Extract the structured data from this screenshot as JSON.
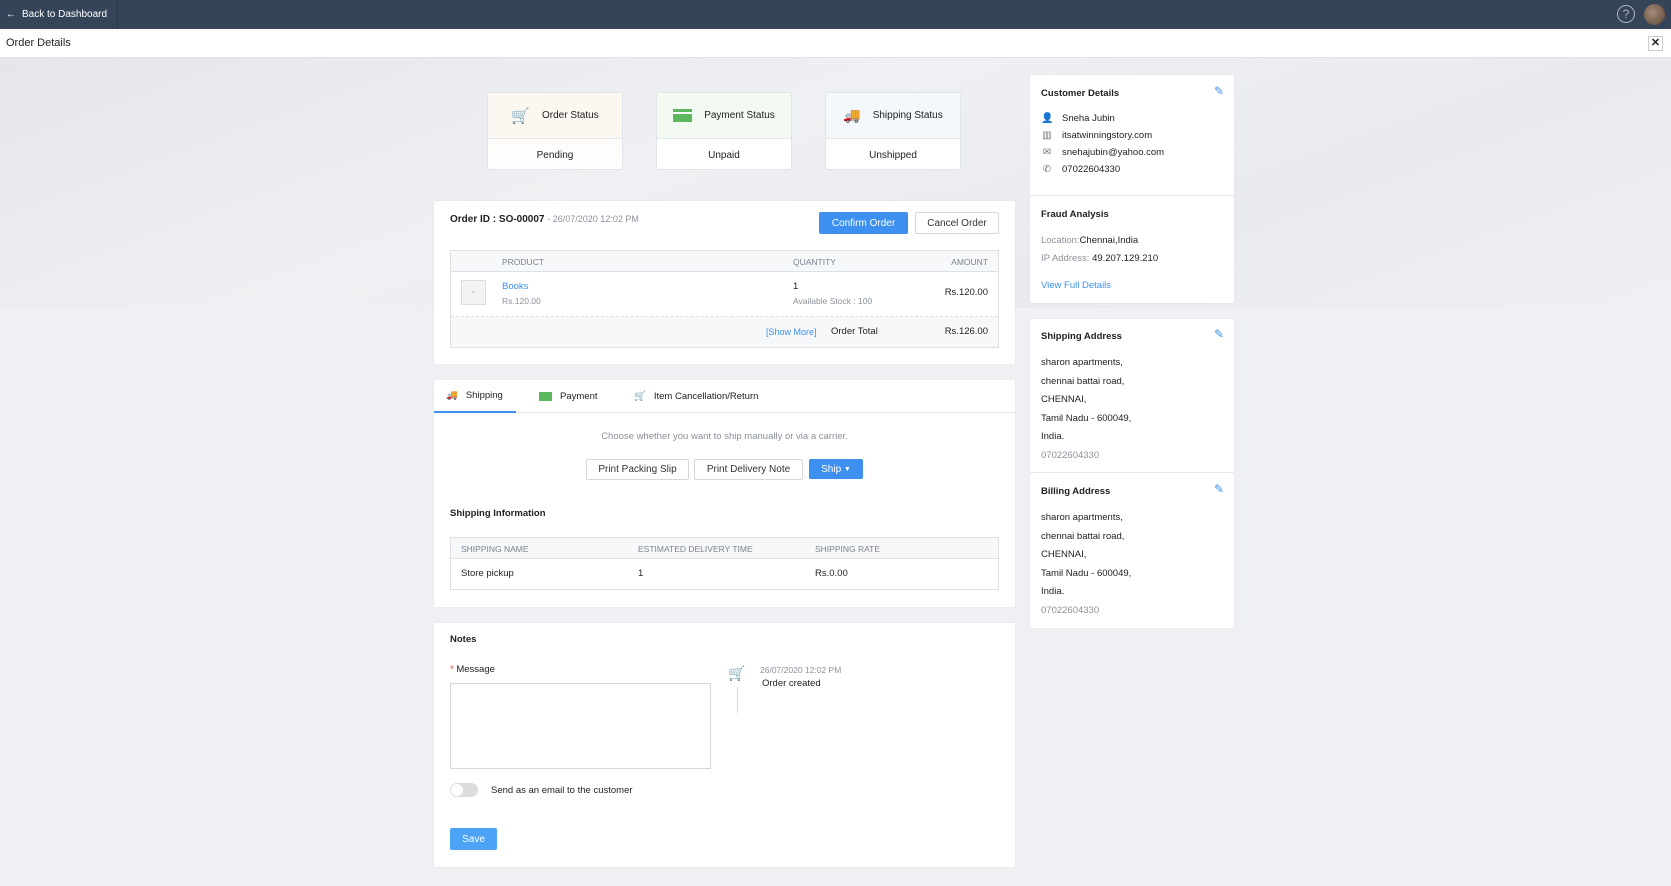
{
  "topbar": {
    "back_label": "Back to Dashboard",
    "help": "?"
  },
  "header": {
    "title": "Order Details",
    "close": "✕"
  },
  "status_cards": [
    {
      "label": "Order Status",
      "value": "Pending",
      "icon": "cart-check-icon",
      "color": "#f0a040"
    },
    {
      "label": "Payment Status",
      "value": "Unpaid",
      "icon": "card-icon",
      "color": "#5cb85c"
    },
    {
      "label": "Shipping Status",
      "value": "Unshipped",
      "icon": "truck-icon",
      "color": "#5bb8e8"
    }
  ],
  "order": {
    "id_label": "Order ID : SO-00007",
    "date": "- 26/07/2020 12:02 PM",
    "confirm": "Confirm Order",
    "cancel": "Cancel Order",
    "headers": {
      "product": "PRODUCT",
      "quantity": "QUANTITY",
      "amount": "AMOUNT"
    },
    "item": {
      "name": "Books",
      "price": "Rs.120.00",
      "qty": "1",
      "stock": "Available Stock : 100",
      "amount": "Rs.120.00"
    },
    "show_more": "[Show More]",
    "total_label": "Order Total",
    "total": "Rs.126.00"
  },
  "tabs": [
    {
      "label": "Shipping"
    },
    {
      "label": "Payment"
    },
    {
      "label": "Item Cancellation/Return"
    }
  ],
  "shipping": {
    "hint": "Choose whether you want to ship manually or via a carrier.",
    "print_slip": "Print Packing Slip",
    "print_note": "Print Delivery Note",
    "ship": "Ship",
    "info_title": "Shipping Information",
    "headers": [
      "SHIPPING NAME",
      "ESTIMATED DELIVERY TIME",
      "SHIPPING RATE"
    ],
    "rows": [
      [
        "Store pickup",
        "1",
        "Rs.0.00"
      ]
    ]
  },
  "notes": {
    "title": "Notes",
    "required": "*",
    "message_label": "Message",
    "message_value": "",
    "toggle_label": "Send as an email to the customer",
    "save": "Save",
    "timeline": [
      {
        "time": "26/07/2020 12:02 PM",
        "text": "Order created"
      }
    ]
  },
  "customer": {
    "title": "Customer Details",
    "name": "Sneha Jubin",
    "company": "itsatwinningstory.com",
    "email": "snehajubin@yahoo.com",
    "phone": "07022604330"
  },
  "fraud": {
    "title": "Fraud Analysis",
    "location_label": "Location:",
    "location": "Chennai,India",
    "ip_label": "IP Address:",
    "ip": "49.207.129.210",
    "link": "View Full Details"
  },
  "shipping_address": {
    "title": "Shipping Address",
    "lines": [
      "sharon apartments,",
      "chennai battai road,",
      "CHENNAI,",
      "Tamil Nadu - 600049,",
      "India."
    ],
    "phone": "07022604330"
  },
  "billing_address": {
    "title": "Billing Address",
    "lines": [
      "sharon apartments,",
      "chennai battai road,",
      "CHENNAI,",
      "Tamil Nadu - 600049,",
      "India."
    ],
    "phone": "07022604330"
  }
}
